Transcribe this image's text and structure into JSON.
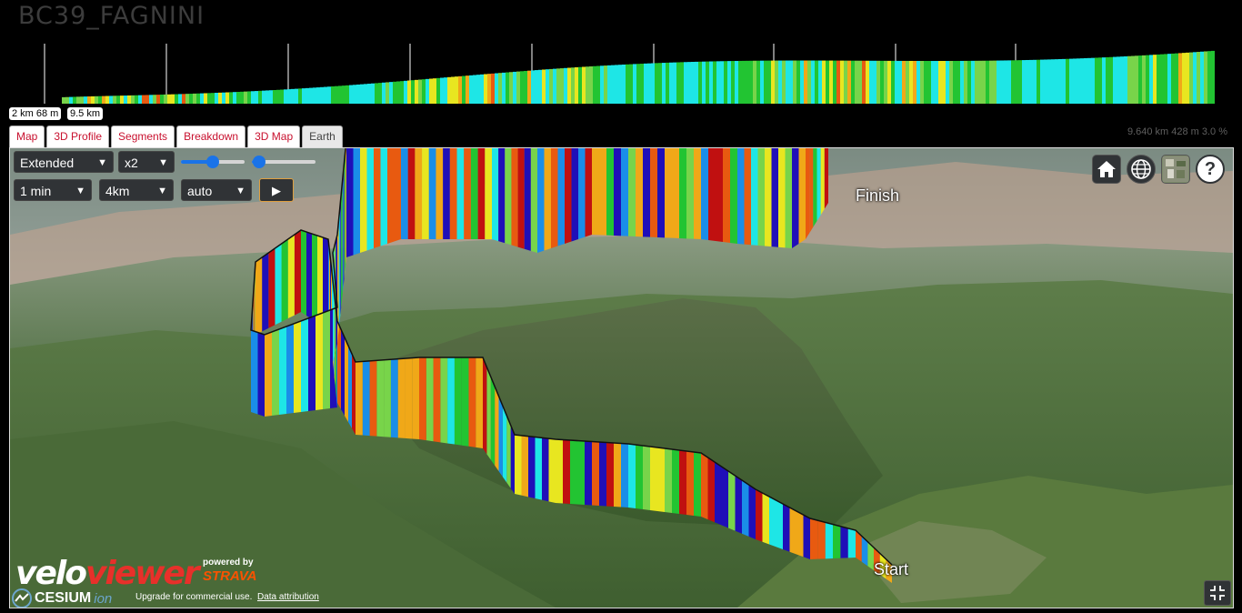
{
  "activity": {
    "title": "BC39_FAGNINI"
  },
  "profile": {
    "scale_left": "2 km 68 m",
    "scale_right": "9.5 km",
    "readout": "9.640 km 428 m 3.0 %"
  },
  "tabs": [
    {
      "label": "Map"
    },
    {
      "label": "3D Profile"
    },
    {
      "label": "Segments"
    },
    {
      "label": "Breakdown"
    },
    {
      "label": "3D Map"
    },
    {
      "label": "Earth",
      "active": true
    }
  ],
  "controls": {
    "mode": "Extended",
    "exaggeration": "x2",
    "time_step": "1 min",
    "distance": "4km",
    "speed": "auto",
    "play_label": "▶",
    "slider1_level": 0.5,
    "slider2_level": 0.12
  },
  "toolbar": {
    "home_icon": "home-icon",
    "globe_icon": "globe-icon",
    "layers_icon": "imagery-layers-icon",
    "help_label": "?"
  },
  "scene": {
    "start_label": "Start",
    "finish_label": "Finish"
  },
  "branding": {
    "velo_a": "velo",
    "velo_b": "viewer",
    "powered_by": "powered by",
    "strava": "STRAVA",
    "cesium": "CESIUM",
    "cesium_ion": "ion",
    "upgrade_text": "Upgrade for commercial use.",
    "attribution_link": "Data attribution"
  },
  "colors": {
    "accent": "#c8102e",
    "gradient_palette": [
      "#1f0fb8",
      "#1a8ee8",
      "#1ee6e6",
      "#22c432",
      "#78d44a",
      "#e8e620",
      "#f0a818",
      "#e85a10",
      "#c01010"
    ]
  }
}
